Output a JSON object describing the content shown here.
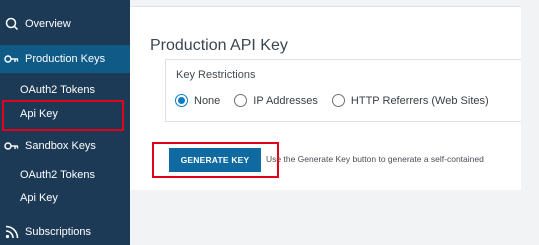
{
  "sidebar": {
    "overview": {
      "label": "Overview",
      "icon": "overview-icon"
    },
    "production_keys": {
      "label": "Production Keys",
      "icon": "keys-icon"
    },
    "production_oauth": {
      "label": "OAuth2 Tokens"
    },
    "production_apikey": {
      "label": "Api Key"
    },
    "sandbox_keys": {
      "label": "Sandbox Keys",
      "icon": "keys-icon"
    },
    "sandbox_oauth": {
      "label": "OAuth2 Tokens"
    },
    "sandbox_apikey": {
      "label": "Api Key"
    },
    "subscriptions": {
      "label": "Subscriptions",
      "icon": "subscriptions-icon"
    }
  },
  "main": {
    "title": "Production API Key",
    "restrictions": {
      "label": "Key Restrictions",
      "options": [
        "None",
        "IP Addresses",
        "HTTP Referrers (Web Sites)"
      ],
      "selected": "None"
    },
    "generate_button": "GENERATE KEY",
    "help_text": "Use the Generate Key button to generate a self-contained"
  },
  "colors": {
    "sidebar_bg": "#1c3a56",
    "active_section": "#0f5a87",
    "accent": "#0a7ec2",
    "button_bg": "#0e6aa0",
    "highlight": "#e3001b"
  }
}
